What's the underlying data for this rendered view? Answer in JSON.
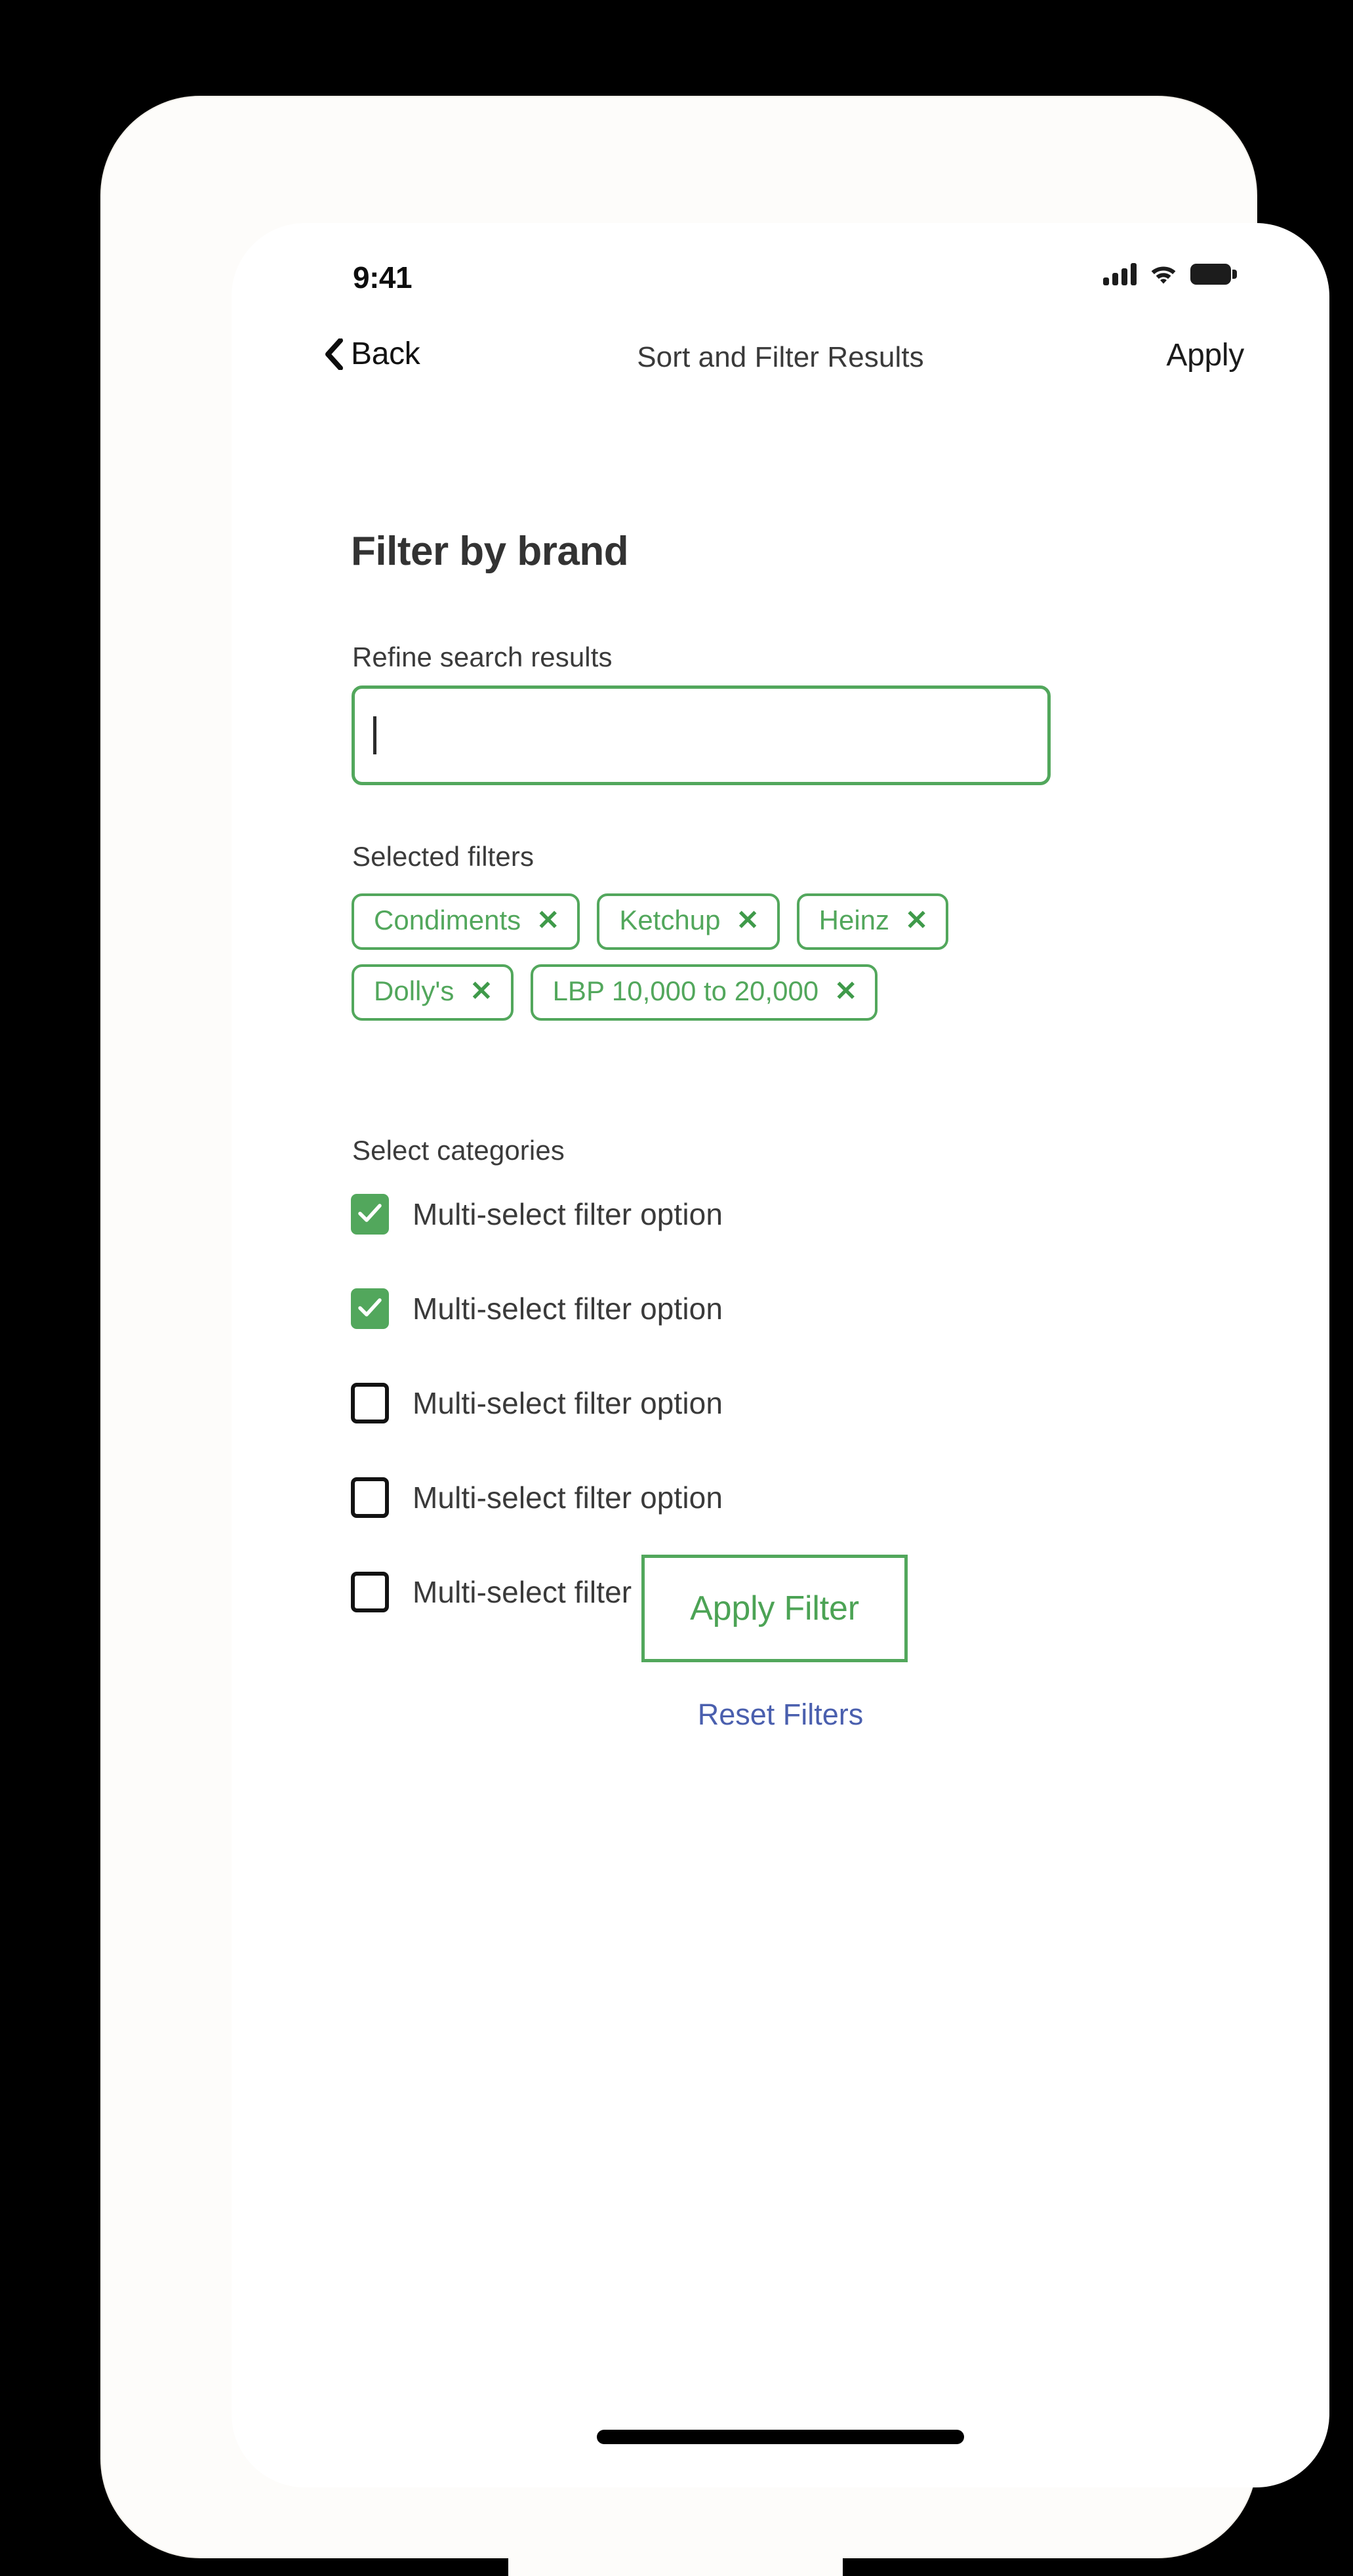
{
  "status_bar": {
    "time": "9:41",
    "signal_icon": "cellular-signal-icon",
    "wifi_icon": "wifi-icon",
    "battery_icon": "battery-full-icon"
  },
  "nav_bar": {
    "back_label": "Back",
    "back_icon": "chevron-left-icon",
    "title": "Sort and Filter Results",
    "apply_label": "Apply"
  },
  "page": {
    "title": "Filter by brand"
  },
  "search": {
    "label": "Refine search results",
    "value": "",
    "placeholder": ""
  },
  "selected_filters": {
    "label": "Selected filters",
    "remove_icon": "close-x-icon",
    "rows": [
      [
        {
          "label": "Condiments"
        },
        {
          "label": "Ketchup"
        },
        {
          "label": "Heinz"
        }
      ],
      [
        {
          "label": "Dolly's"
        },
        {
          "label": "LBP 10,000 to 20,000"
        }
      ]
    ]
  },
  "categories": {
    "label": "Select categories",
    "items": [
      {
        "label": "Multi-select filter option",
        "checked": true
      },
      {
        "label": "Multi-select filter option",
        "checked": true
      },
      {
        "label": "Multi-select filter option",
        "checked": false
      },
      {
        "label": "Multi-select filter option",
        "checked": false
      },
      {
        "label": "Multi-select filter option",
        "checked": false
      }
    ]
  },
  "actions": {
    "apply_filter_label": "Apply Filter",
    "reset_label": "Reset Filters"
  },
  "colors": {
    "brand_green": "#52a75c",
    "link_blue": "#4a5fae",
    "text_dark": "#333333"
  }
}
